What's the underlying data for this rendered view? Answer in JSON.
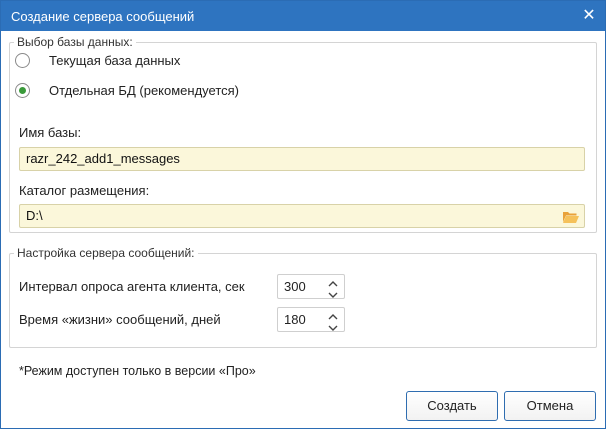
{
  "window": {
    "title": "Создание сервера сообщений",
    "close_icon": "close-icon"
  },
  "db_group": {
    "legend": "Выбор базы данных:",
    "radios": [
      {
        "label": "Текущая база данных",
        "checked": false
      },
      {
        "label": "Отдельная БД (рекомендуется)",
        "checked": true
      }
    ],
    "name_label": "Имя базы:",
    "name_value": "razr_242_add1_messages",
    "path_label": "Каталог размещения:",
    "path_value": "D:\\",
    "folder_icon": "folder-open-icon"
  },
  "server_group": {
    "legend": "Настройка сервера сообщений:",
    "poll_label": "Интервал опроса агента клиента, сек",
    "poll_value": "300",
    "ttl_label": "Время «жизни» сообщений, дней",
    "ttl_value": "180"
  },
  "note": "*Режим доступен только в версии «Про»",
  "buttons": {
    "create": "Создать",
    "cancel": "Отмена"
  },
  "colors": {
    "titlebar": "#2e74c0",
    "input_bg": "#fbf7da",
    "radio_checked": "#3a9a3a",
    "button_border": "#2f6db0"
  }
}
